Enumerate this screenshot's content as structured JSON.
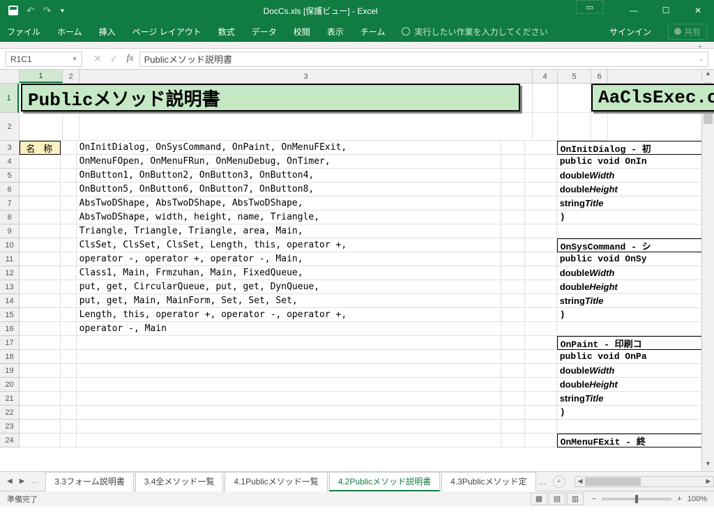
{
  "window": {
    "title": "DocCs.xls  [保護ビュー] - Excel"
  },
  "ribbon": {
    "tabs": [
      "ファイル",
      "ホーム",
      "挿入",
      "ページ レイアウト",
      "数式",
      "データ",
      "校閲",
      "表示",
      "チーム"
    ],
    "tellme": "実行したい作業を入力してください",
    "signin": "サインイン",
    "share": "共有"
  },
  "formula_bar": {
    "name_box": "R1C1",
    "formula": "Publicメソッド説明書"
  },
  "columns": {
    "headers": [
      "1",
      "2",
      "3",
      "4",
      "5",
      "6"
    ],
    "widths": [
      62,
      24,
      650,
      36,
      48,
      24
    ]
  },
  "sheet": {
    "title_main": "Publicメソッド説明書",
    "title_file": "AaClsExec.cs",
    "header_label": "名 称",
    "rows": [
      "OnInitDialog, OnSysCommand, OnPaint, OnMenuFExit,",
      "OnMenuFOpen, OnMenuFRun, OnMenuDebug, OnTimer,",
      "OnButton1, OnButton2, OnButton3, OnButton4,",
      "OnButton5, OnButton6, OnButton7, OnButton8,",
      "AbsTwoDShape, AbsTwoDShape, AbsTwoDShape,",
      "AbsTwoDShape, width, height, name, Triangle,",
      "Triangle, Triangle, Triangle, area, Main,",
      "ClsSet, ClsSet, ClsSet, Length, this, operator +,",
      "operator -, operator +, operator -, Main,",
      "Class1, Main, Frmzuhan, Main, FixedQueue,",
      "put, get, CircularQueue, put, get, DynQueue,",
      "put, get, Main, MainForm, Set, Set, Set,",
      "Length, this, operator +, operator -, operator +,",
      "operator -, Main"
    ],
    "right_blocks": [
      {
        "title": "OnInitDialog - 初",
        "sig": "public void OnIn",
        "lines": [
          "double Width",
          "double Height",
          "string Title"
        ],
        "close": ")"
      },
      {
        "title": "OnSysCommand - シ",
        "sig": "public void OnSy",
        "lines": [
          "double Width",
          "double Height",
          "string Title"
        ],
        "close": ")"
      },
      {
        "title": "OnPaint  - 印刷コ",
        "sig": "public void OnPa",
        "lines": [
          "double Width",
          "double Height",
          "string Title"
        ],
        "close": ")"
      },
      {
        "title": "OnMenuFExit - 終"
      }
    ]
  },
  "tabs": {
    "list": [
      "3.3フォーム説明書",
      "3.4全メソッド一覧",
      "4.1Publicメソッド一覧",
      "4.2Publicメソッド説明書",
      "4.3Publicメソッド定"
    ],
    "active_index": 3,
    "ellipsis_right": "..."
  },
  "status": {
    "ready": "準備完了",
    "zoom": "100%"
  }
}
